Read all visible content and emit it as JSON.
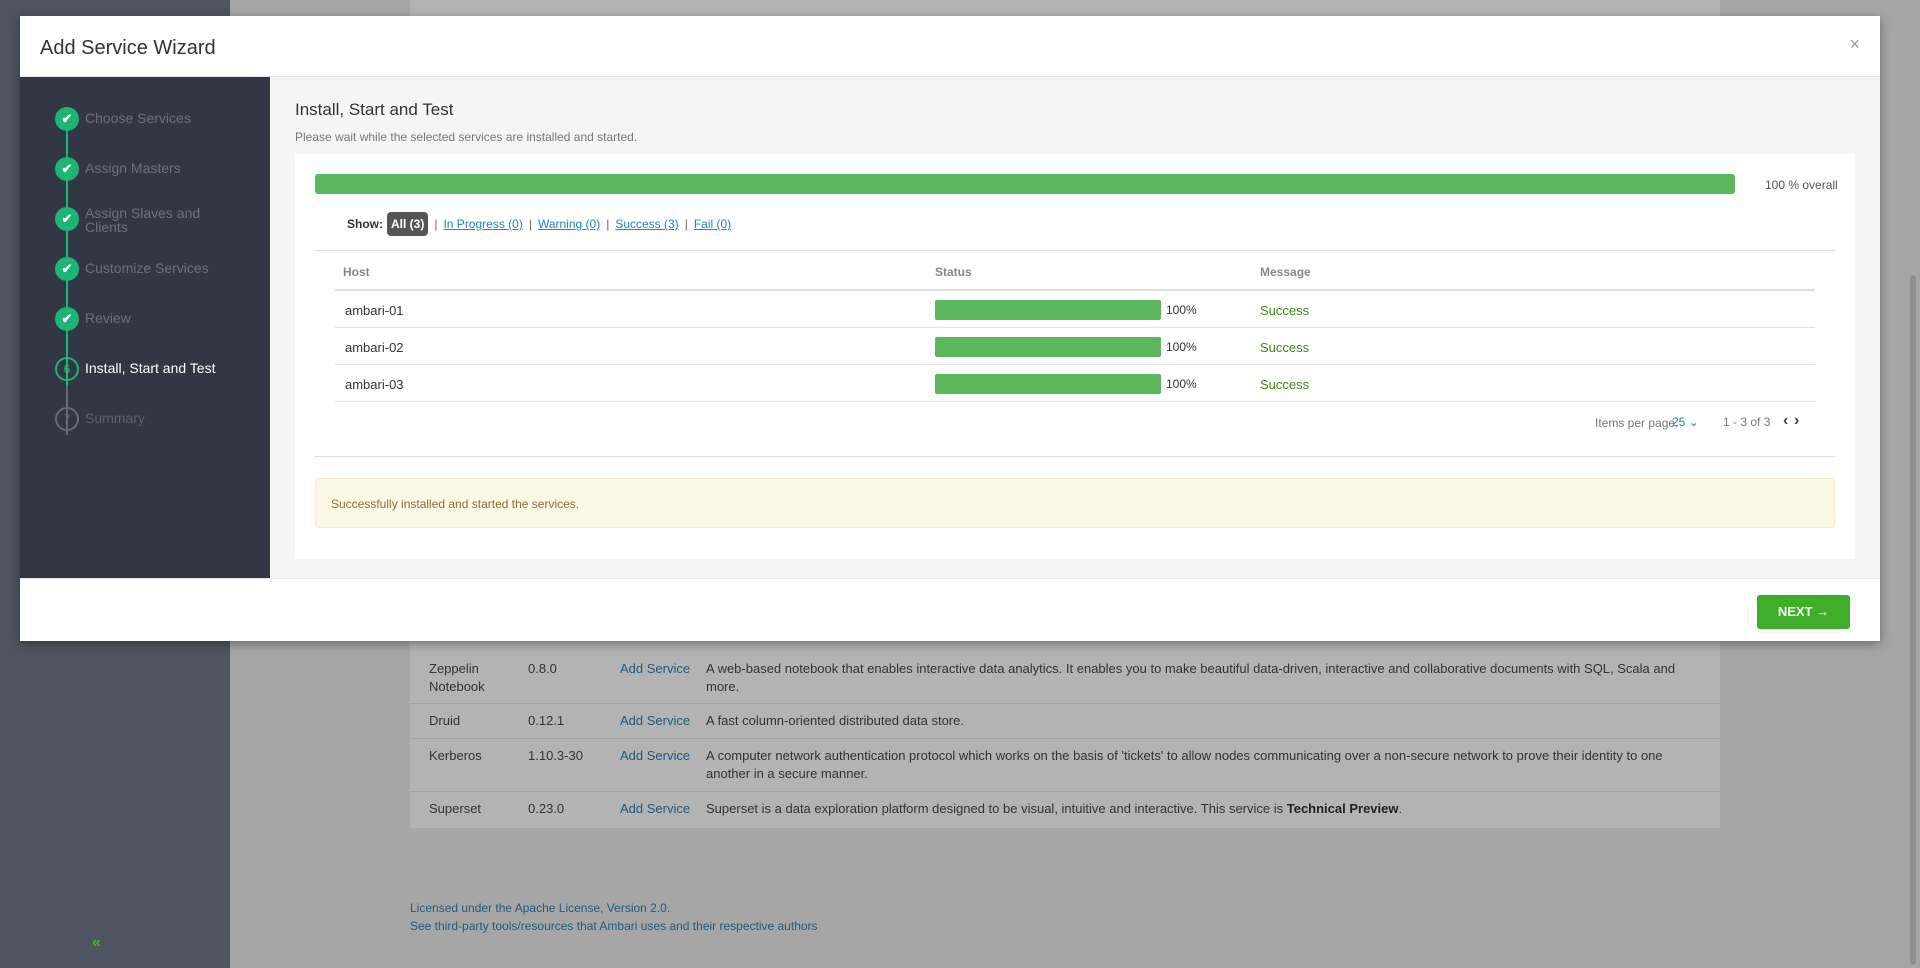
{
  "background": {
    "collapse_glyph": "«",
    "services": [
      {
        "name": "Zeppelin Notebook",
        "version": "0.8.0",
        "action": "Add Service",
        "description": "A web-based notebook that enables interactive data analytics. It enables you to make beautiful data-driven, interactive and collaborative documents with SQL, Scala and more."
      },
      {
        "name": "Druid",
        "version": "0.12.1",
        "action": "Add Service",
        "description": "A fast column-oriented distributed data store."
      },
      {
        "name": "Kerberos",
        "version": "1.10.3-30",
        "action": "Add Service",
        "description": "A computer network authentication protocol which works on the basis of 'tickets' to allow nodes communicating over a non-secure network to prove their identity to one another in a secure manner."
      },
      {
        "name": "Superset",
        "version": "0.23.0",
        "action": "Add Service",
        "description": "Superset is a data exploration platform designed to be visual, intuitive and interactive. This service is ",
        "description_bold": "Technical Preview",
        "description_end": "."
      }
    ],
    "footer": {
      "license": "Licensed under the Apache License, Version 2.0.",
      "third_party": "See third-party tools/resources that Ambari uses and their respective authors"
    }
  },
  "modal": {
    "title": "Add Service Wizard",
    "close_glyph": "×",
    "steps": [
      {
        "number": "1",
        "label": "Choose Services",
        "state": "done"
      },
      {
        "number": "2",
        "label": "Assign Masters",
        "state": "done"
      },
      {
        "number": "3",
        "label": "Assign Slaves and Clients",
        "state": "done"
      },
      {
        "number": "4",
        "label": "Customize Services",
        "state": "done"
      },
      {
        "number": "5",
        "label": "Review",
        "state": "done"
      },
      {
        "number": "6",
        "label": "Install, Start and Test",
        "state": "current"
      },
      {
        "number": "7",
        "label": "Summary",
        "state": "future"
      }
    ],
    "check_glyph": "✔",
    "content": {
      "title": "Install, Start and Test",
      "subtitle": "Please wait while the selected services are installed and started.",
      "overall_progress": 100,
      "overall_label": "100 % overall",
      "filter": {
        "show_label": "Show:",
        "all": "All (3)",
        "in_progress": "In Progress (0)",
        "warning": "Warning (0)",
        "success": "Success (3)",
        "fail": "Fail (0)"
      },
      "table": {
        "headers": {
          "host": "Host",
          "status": "Status",
          "message": "Message"
        },
        "rows": [
          {
            "host": "ambari-01",
            "progress": 100,
            "percent": "100%",
            "message": "Success"
          },
          {
            "host": "ambari-02",
            "progress": 100,
            "percent": "100%",
            "message": "Success"
          },
          {
            "host": "ambari-03",
            "progress": 100,
            "percent": "100%",
            "message": "Success"
          }
        ]
      },
      "pager": {
        "label": "Items per page:",
        "per_page": "25",
        "range": "1 - 3 of 3"
      },
      "alert": "Successfully installed and started the services."
    },
    "next_button": "NEXT →"
  }
}
